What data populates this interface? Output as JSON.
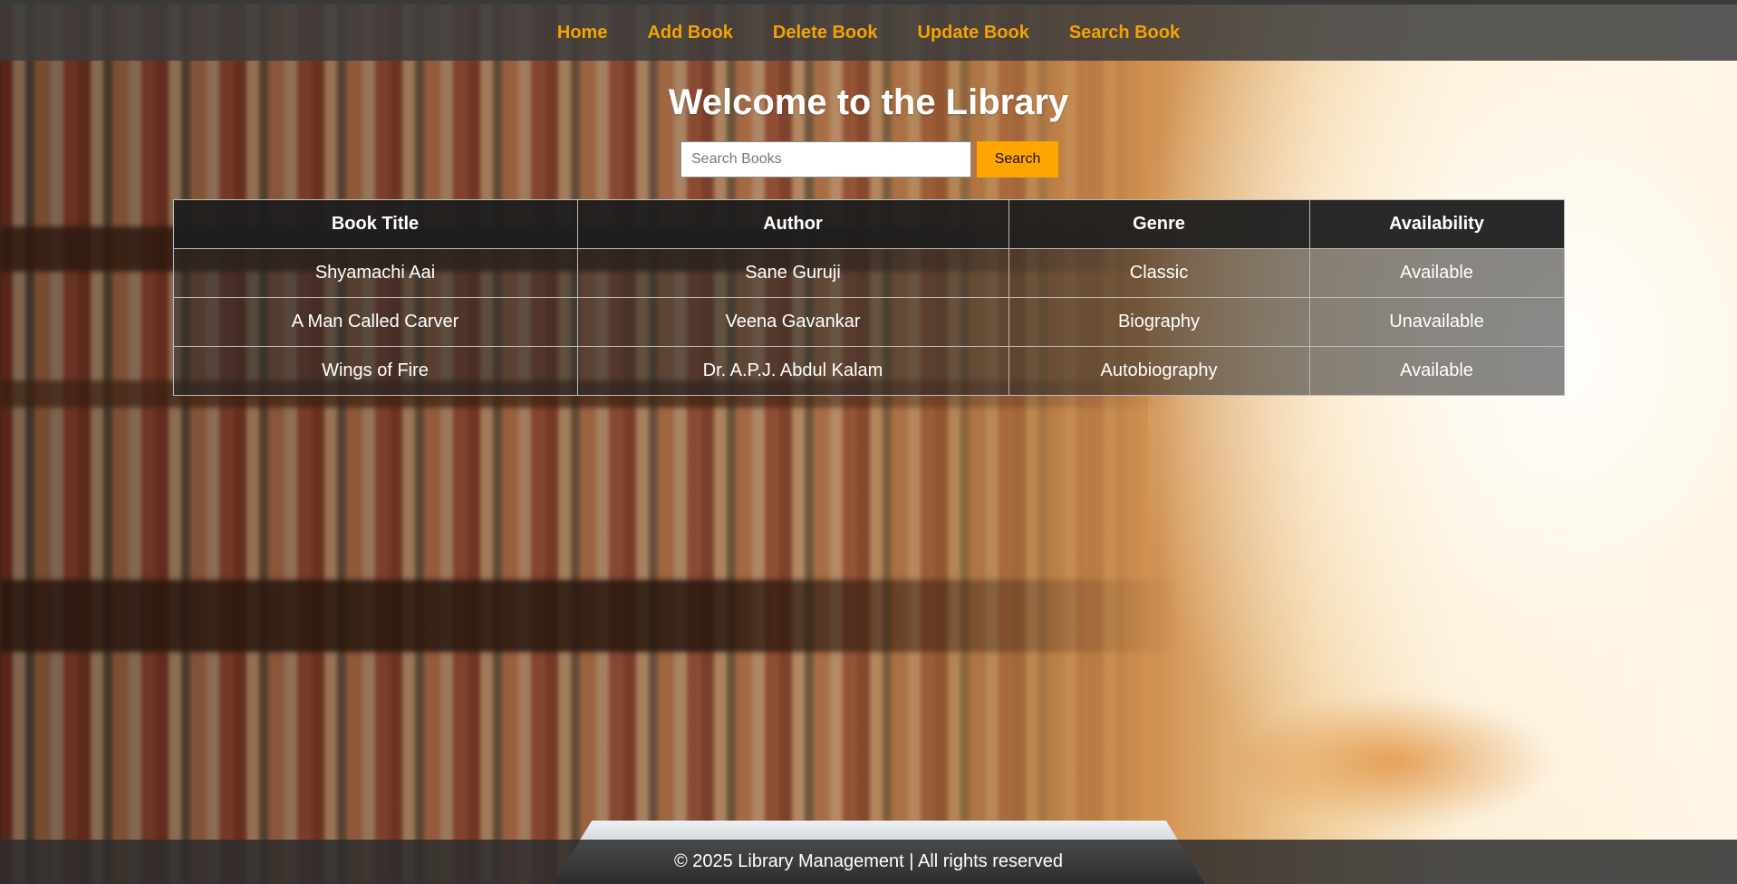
{
  "nav": {
    "items": [
      {
        "label": "Home"
      },
      {
        "label": "Add Book"
      },
      {
        "label": "Delete Book"
      },
      {
        "label": "Update Book"
      },
      {
        "label": "Search Book"
      }
    ]
  },
  "main": {
    "title": "Welcome to the Library",
    "search": {
      "placeholder": "Search Books",
      "value": "",
      "button_label": "Search"
    },
    "table": {
      "headers": [
        "Book Title",
        "Author",
        "Genre",
        "Availability"
      ],
      "rows": [
        [
          "Shyamachi Aai",
          "Sane Guruji",
          "Classic",
          "Available"
        ],
        [
          "A Man Called Carver",
          "Veena Gavankar",
          "Biography",
          "Unavailable"
        ],
        [
          "Wings of Fire",
          "Dr. A.P.J. Abdul Kalam",
          "Autobiography",
          "Available"
        ]
      ]
    }
  },
  "footer": {
    "text": "© 2025 Library Management | All rights reserved"
  },
  "colors": {
    "accent": "#ffa500",
    "nav_link": "#f5a300",
    "navbar_bg": "#3c3c3c",
    "table_header_bg": "#1e1e1e"
  }
}
